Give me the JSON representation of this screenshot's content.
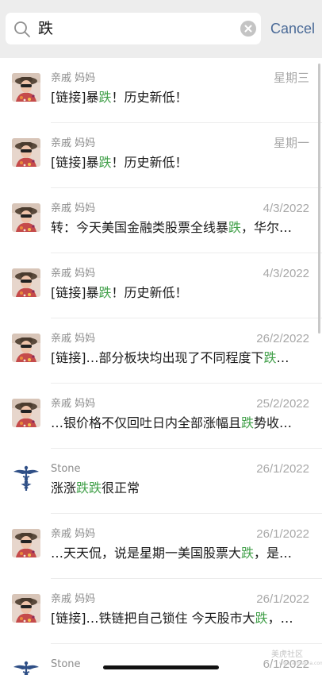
{
  "search": {
    "query": "跌",
    "cancel_label": "Cancel"
  },
  "colors": {
    "highlight": "#42a04a",
    "cancel": "#4a6a97",
    "search_bar_bg": "#ededed"
  },
  "results": [
    {
      "avatar": "woman-avatar",
      "name": "亲戚 妈妈",
      "date": "星期三",
      "segments": [
        "[链接]暴",
        "跌",
        "！历史新低！"
      ]
    },
    {
      "avatar": "woman-avatar",
      "name": "亲戚 妈妈",
      "date": "星期一",
      "segments": [
        "[链接]暴",
        "跌",
        "！历史新低！"
      ]
    },
    {
      "avatar": "woman-avatar",
      "name": "亲戚 妈妈",
      "date": "4/3/2022",
      "segments": [
        "转：今天美国金融类股票全线暴",
        "跌",
        "，华尔…"
      ]
    },
    {
      "avatar": "woman-avatar",
      "name": "亲戚 妈妈",
      "date": "4/3/2022",
      "segments": [
        "[链接]暴",
        "跌",
        "！历史新低！"
      ]
    },
    {
      "avatar": "woman-avatar",
      "name": "亲戚 妈妈",
      "date": "26/2/2022",
      "segments": [
        "[链接]…部分板块均出现了不同程度下",
        "跌",
        "…"
      ]
    },
    {
      "avatar": "woman-avatar",
      "name": "亲戚 妈妈",
      "date": "25/2/2022",
      "segments": [
        "…银价格不仅回吐日内全部涨幅且",
        "跌",
        "势收…"
      ]
    },
    {
      "avatar": "caduceus-avatar",
      "name": "Stone",
      "date": "26/1/2022",
      "segments": [
        "涨涨",
        "跌跌",
        "很正常"
      ]
    },
    {
      "avatar": "woman-avatar",
      "name": "亲戚 妈妈",
      "date": "26/1/2022",
      "segments": [
        "…天天侃，说是星期一美国股票大",
        "跌",
        "，是…"
      ]
    },
    {
      "avatar": "woman-avatar",
      "name": "亲戚 妈妈",
      "date": "26/1/2022",
      "segments": [
        "[链接]…铁链把自己锁住 今天股市大",
        "跌",
        "，…"
      ]
    },
    {
      "avatar": "caduceus-avatar",
      "name": "Stone",
      "date": "6/1/2022",
      "segments": [
        "",
        "",
        ""
      ]
    }
  ],
  "watermark": {
    "text": "美虎社区",
    "subtext": "www.alimama.com"
  }
}
